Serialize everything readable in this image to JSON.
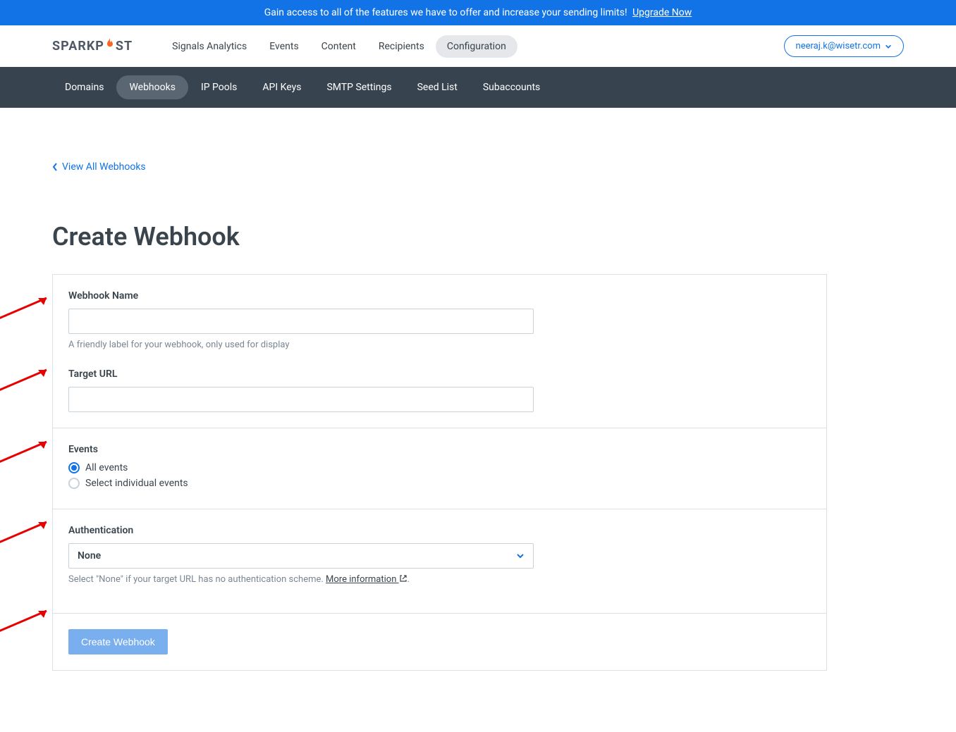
{
  "banner": {
    "text": "Gain access to all of the features we have to offer and increase your sending limits!",
    "link_text": "Upgrade Now"
  },
  "logo": {
    "prefix": "SPARKP",
    "suffix": "ST"
  },
  "main_nav": [
    {
      "label": "Signals Analytics",
      "active": false
    },
    {
      "label": "Events",
      "active": false
    },
    {
      "label": "Content",
      "active": false
    },
    {
      "label": "Recipients",
      "active": false
    },
    {
      "label": "Configuration",
      "active": true
    }
  ],
  "user_email": "neeraj.k@wisetr.com",
  "sub_nav": [
    {
      "label": "Domains",
      "active": false
    },
    {
      "label": "Webhooks",
      "active": true
    },
    {
      "label": "IP Pools",
      "active": false
    },
    {
      "label": "API Keys",
      "active": false
    },
    {
      "label": "SMTP Settings",
      "active": false
    },
    {
      "label": "Seed List",
      "active": false
    },
    {
      "label": "Subaccounts",
      "active": false
    }
  ],
  "back_link": "View All Webhooks",
  "page_title": "Create Webhook",
  "form": {
    "name": {
      "label": "Webhook Name",
      "value": "",
      "help": "A friendly label for your webhook, only used for display"
    },
    "target": {
      "label": "Target URL",
      "value": ""
    },
    "events": {
      "label": "Events",
      "options": [
        {
          "label": "All events",
          "checked": true
        },
        {
          "label": "Select individual events",
          "checked": false
        }
      ]
    },
    "auth": {
      "label": "Authentication",
      "selected": "None",
      "help_prefix": "Select \"None\" if your target URL has no authentication scheme. ",
      "help_link": "More information",
      "help_suffix": "."
    },
    "submit": "Create Webhook"
  }
}
